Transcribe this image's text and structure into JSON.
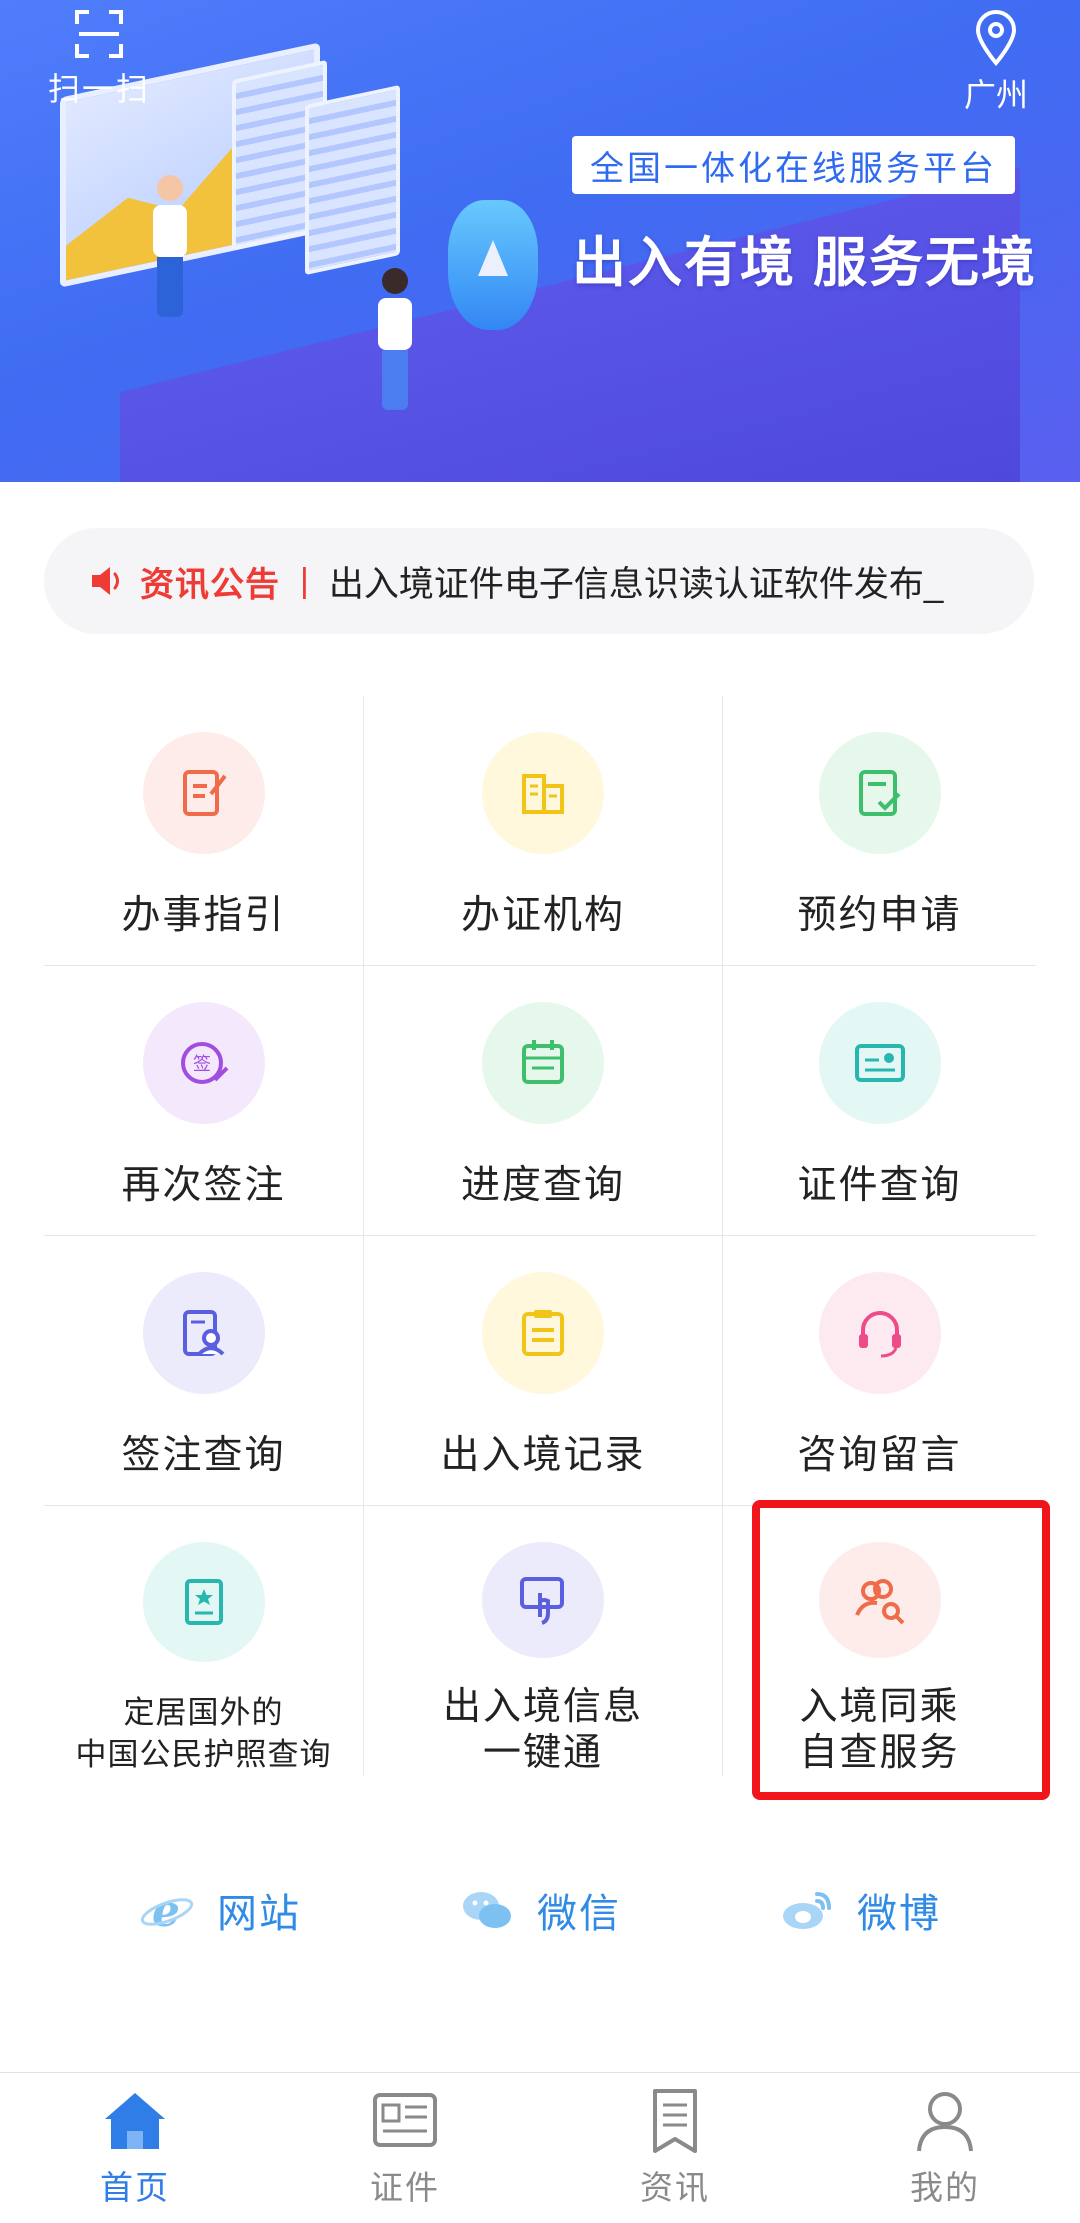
{
  "header": {
    "scan_label": "扫一扫",
    "location_label": "广州",
    "slogan_box": "全国一体化在线服务平台",
    "slogan_main": "出入有境  服务无境"
  },
  "notice": {
    "tag": "资讯公告",
    "separator": "|",
    "text": "出入境证件电子信息识读认证软件发布_"
  },
  "services": [
    {
      "label": "办事指引",
      "icon": "guide-icon",
      "color": "#ef6b4a",
      "bg": "#fdecea"
    },
    {
      "label": "办证机构",
      "icon": "building-icon",
      "color": "#f0c419",
      "bg": "#fff8dc"
    },
    {
      "label": "预约申请",
      "icon": "appointment-icon",
      "color": "#3dbf6e",
      "bg": "#e6f7ec"
    },
    {
      "label": "再次签注",
      "icon": "sign-icon",
      "color": "#a14de0",
      "bg": "#f4e9fc"
    },
    {
      "label": "进度查询",
      "icon": "calendar-icon",
      "color": "#3dbf6e",
      "bg": "#e6f7ec"
    },
    {
      "label": "证件查询",
      "icon": "id-card-icon",
      "color": "#26b8b0",
      "bg": "#e3f7f5"
    },
    {
      "label": "签注查询",
      "icon": "visa-search-icon",
      "color": "#5a5fe0",
      "bg": "#ecebfb"
    },
    {
      "label": "出入境记录",
      "icon": "record-icon",
      "color": "#f0c419",
      "bg": "#fff8dc"
    },
    {
      "label": "咨询留言",
      "icon": "headset-icon",
      "color": "#ef4a8a",
      "bg": "#fdeaf1"
    },
    {
      "label_line1": "定居国外的",
      "label_line2": "中国公民护照查询",
      "icon": "passport-icon",
      "color": "#26b8b0",
      "bg": "#e3f7f5"
    },
    {
      "label_line1": "出入境信息",
      "label_line2": "一键通",
      "icon": "touch-icon",
      "color": "#5a5fe0",
      "bg": "#ecebfb"
    },
    {
      "label_line1": "入境同乘",
      "label_line2": "自查服务",
      "icon": "people-search-icon",
      "color": "#ef6b4a",
      "bg": "#fdecea"
    }
  ],
  "social": {
    "website": "网站",
    "wechat": "微信",
    "weibo": "微博"
  },
  "tabs": {
    "home": "首页",
    "documents": "证件",
    "news": "资讯",
    "mine": "我的"
  },
  "colors": {
    "accent": "#2f7de6",
    "highlight": "#f0141b",
    "notice_red": "#ef3b35"
  }
}
